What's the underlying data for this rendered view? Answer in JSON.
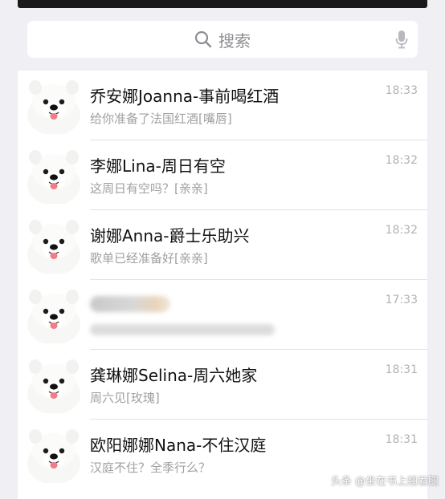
{
  "search": {
    "placeholder": "搜索"
  },
  "chats": [
    {
      "name": "乔安娜Joanna-事前喝红酒",
      "preview": "给你准备了法国红酒[嘴唇]",
      "time": "18:33"
    },
    {
      "name": "李娜Lina-周日有空",
      "preview": "这周日有空吗？[亲亲]",
      "time": "18:32"
    },
    {
      "name": "谢娜Anna-爵士乐助兴",
      "preview": "歌单已经准备好[亲亲]",
      "time": "18:32"
    },
    {
      "name": "",
      "preview": "",
      "time": "17:33"
    },
    {
      "name": "龚琳娜Selina-周六她家",
      "preview": "周六见[玫瑰]",
      "time": "18:31"
    },
    {
      "name": "欧阳娜娜Nana-不住汉庭",
      "preview": "汉庭不住？全季行么？",
      "time": "18:31"
    }
  ],
  "watermark": "头条 @坐在书上翘着腿",
  "icons": {
    "search": "search-icon",
    "mic": "microphone-icon",
    "avatar": "white-dog-avatar-icon"
  }
}
